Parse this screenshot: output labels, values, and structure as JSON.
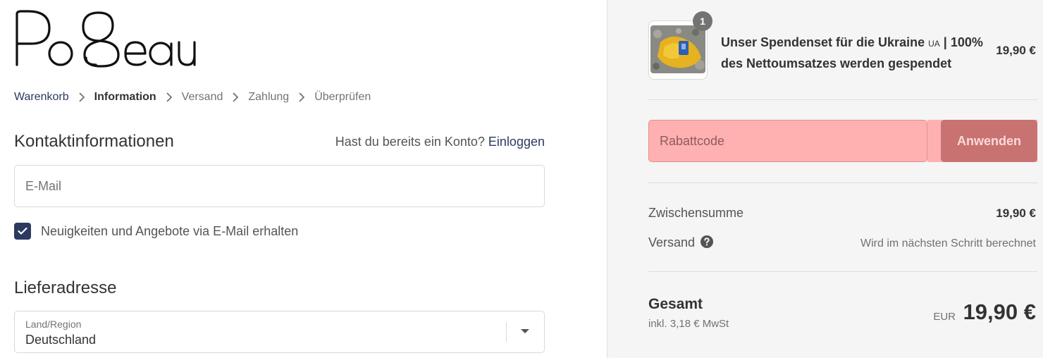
{
  "brand": {
    "logo_text": "PoBeau"
  },
  "breadcrumb": {
    "items": [
      "Warenkorb",
      "Information",
      "Versand",
      "Zahlung",
      "Überprüfen"
    ]
  },
  "contact": {
    "title": "Kontaktinformationen",
    "account_question": "Hast du bereits ein Konto?",
    "login_link": "Einloggen",
    "email_placeholder": "E-Mail",
    "newsletter_label": "Neuigkeiten und Angebote via E-Mail erhalten",
    "newsletter_checked": true
  },
  "shipping": {
    "title": "Lieferadresse",
    "country_label": "Land/Region",
    "country_value": "Deutschland"
  },
  "summary": {
    "product": {
      "name_part1": "Unser Spendenset für die Ukraine",
      "name_small": "UA",
      "name_part2": "| 100% des Nettoumsatzes werden gespendet",
      "quantity": "1",
      "price": "19,90 €"
    },
    "discount": {
      "placeholder": "Rabattcode",
      "apply_label": "Anwenden"
    },
    "subtotal_label": "Zwischensumme",
    "subtotal_value": "19,90 €",
    "shipping_label": "Versand",
    "shipping_note": "Wird im nächsten Schritt berechnet",
    "total_label": "Gesamt",
    "tax_note": "inkl. 3,18 € MwSt",
    "currency": "EUR",
    "total_value": "19,90 €"
  },
  "colors": {
    "accent": "#2c3a60",
    "discount_highlight": "#ffb1b1",
    "apply_button": "#c87272"
  }
}
